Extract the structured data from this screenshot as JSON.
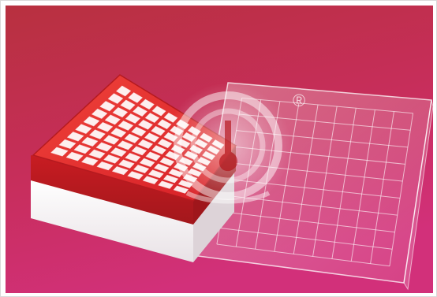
{
  "image": {
    "subject": "cryobox-with-lid",
    "watermark_mark": "®",
    "colors": {
      "background_top": "#b8303f",
      "background_bottom": "#cf2f72",
      "box_red": "#e3262b",
      "box_red_dark": "#b51a1f",
      "box_base": "#f6f1f3",
      "lid_line": "#ffffff"
    },
    "grid": {
      "rows": 9,
      "cols": 9
    }
  }
}
